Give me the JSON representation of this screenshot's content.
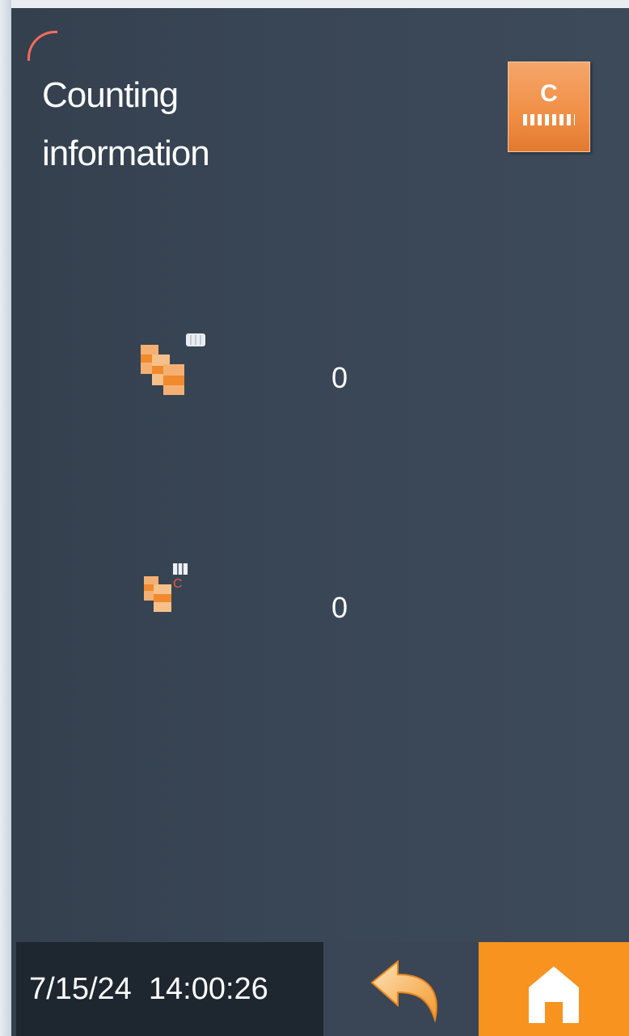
{
  "page": {
    "title": "Counting information"
  },
  "header": {
    "clear_button": {
      "label": "C",
      "icon": "clear-counter-icon"
    }
  },
  "counters": [
    {
      "icon": "total-count-icon",
      "value": "0"
    },
    {
      "icon": "clearable-count-icon",
      "value": "0"
    }
  ],
  "footer": {
    "datetime": "7/15/24  14:00:26",
    "back_icon": "back-arrow-icon",
    "home_icon": "home-icon"
  },
  "colors": {
    "background": "#394656",
    "accent": "#f7931e",
    "button_orange": "#f08e44",
    "corner_arc": "#f36d5c",
    "footer_dark": "#1e262f"
  }
}
